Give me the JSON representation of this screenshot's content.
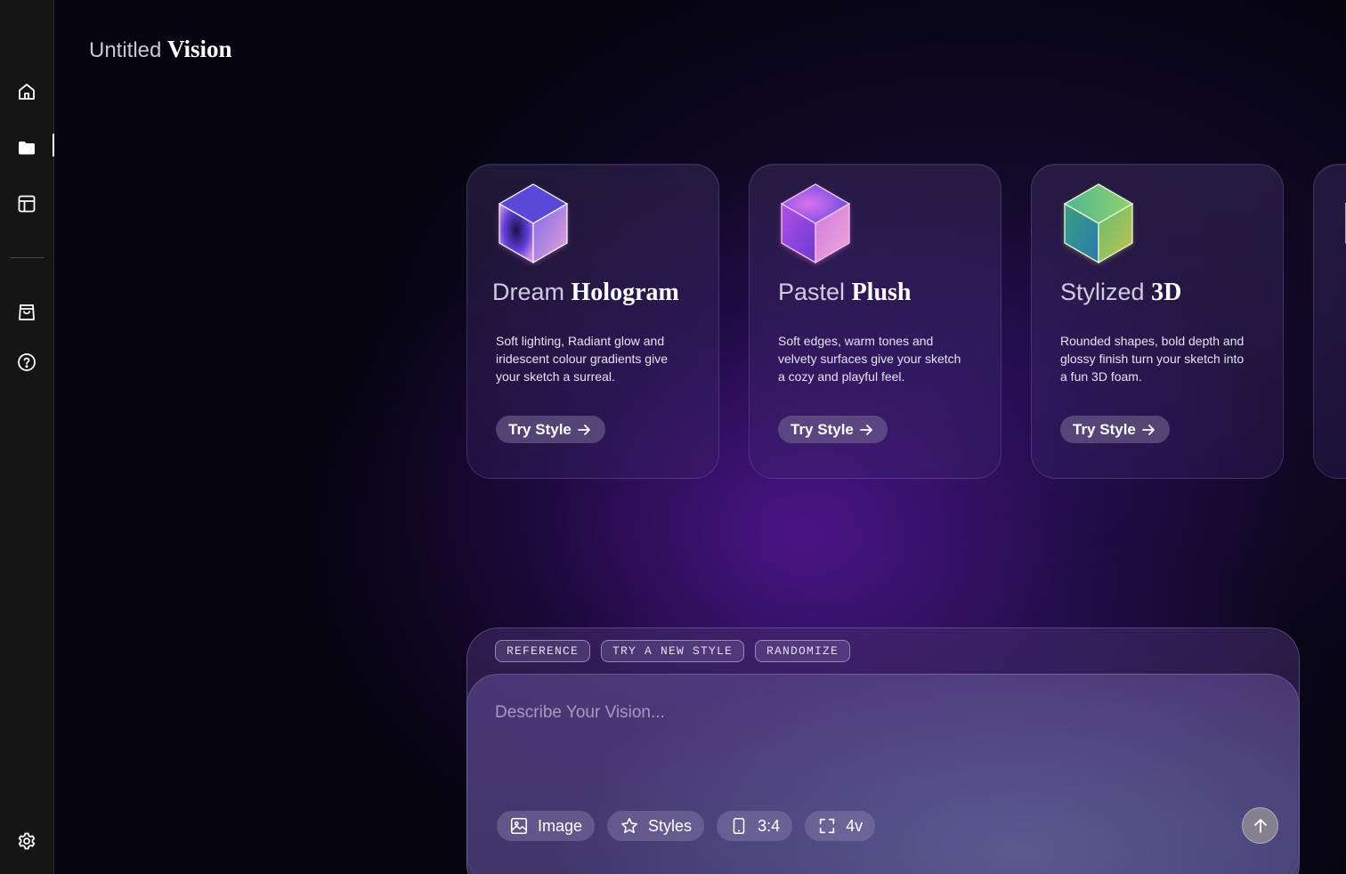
{
  "app": {
    "title_light": "Untitled",
    "title_bold": "Vision"
  },
  "sidebar": {
    "items": [
      {
        "name": "home",
        "icon": "home-icon",
        "active": false
      },
      {
        "name": "folder",
        "icon": "folder-icon",
        "active": true
      },
      {
        "name": "layout",
        "icon": "layout-icon",
        "active": false
      },
      {
        "name": "shop",
        "icon": "shopping-bag-icon",
        "active": false
      },
      {
        "name": "help",
        "icon": "help-icon",
        "active": false
      },
      {
        "name": "settings",
        "icon": "gear-icon",
        "active": false
      }
    ]
  },
  "cards": [
    {
      "title_light": "Dream",
      "title_bold": "Hologram",
      "description": "Soft lighting, Radiant glow and iridescent colour gradients give your sketch a surreal.",
      "button_label": "Try Style",
      "icon": "cube-icon"
    },
    {
      "title_light": "Pastel",
      "title_bold": "Plush",
      "description": "Soft edges, warm tones and velvety surfaces give your sketch a cozy and playful feel.",
      "button_label": "Try Style",
      "icon": "cube-icon"
    },
    {
      "title_light": "Stylized",
      "title_bold": "3D",
      "description": "Rounded shapes, bold depth and glossy finish turn your sketch into a fun 3D foam.",
      "button_label": "Try Style",
      "icon": "cube-icon"
    }
  ],
  "prompt": {
    "chips": [
      "REFERENCE",
      "TRY A NEW STYLE",
      "RANDOMIZE"
    ],
    "placeholder": "Describe Your Vision...",
    "tools": {
      "image": "Image",
      "styles": "Styles",
      "ratio": "3:4",
      "variations": "4v"
    },
    "send_icon": "arrow-up-icon"
  },
  "colors": {
    "background": "#05040f",
    "sidebar": "#151515",
    "accent_purple": "#7a1ed2"
  }
}
